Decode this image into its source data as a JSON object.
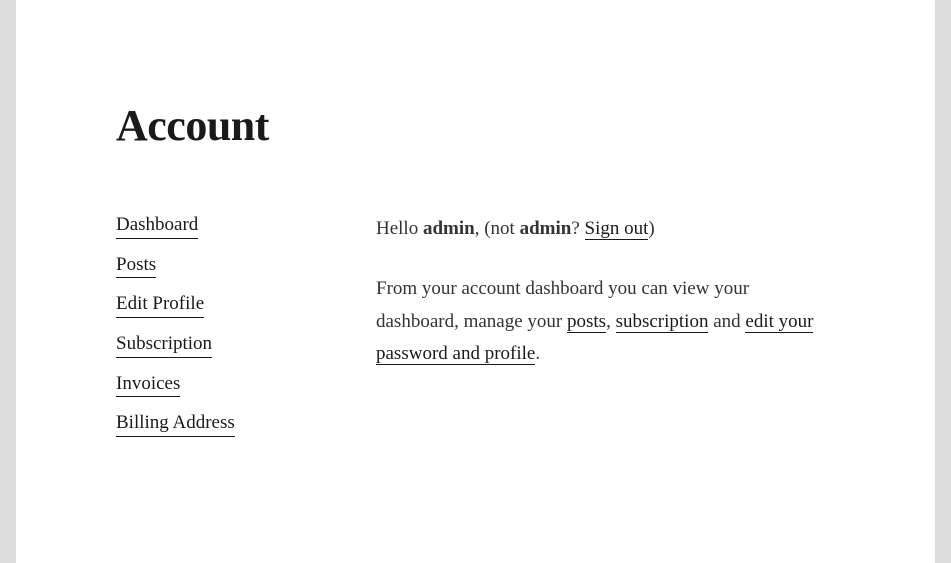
{
  "title": "Account",
  "sidebar": {
    "items": [
      {
        "label": "Dashboard"
      },
      {
        "label": "Posts"
      },
      {
        "label": "Edit Profile"
      },
      {
        "label": "Subscription"
      },
      {
        "label": "Invoices"
      },
      {
        "label": "Billing Address"
      }
    ]
  },
  "main": {
    "greeting_prefix": "Hello ",
    "username": "admin",
    "not_prefix": ", (not ",
    "not_username": "admin",
    "not_qmark": "? ",
    "signout_label": "Sign out",
    "not_suffix": ")",
    "para_prefix": "From your account dashboard you can view your dashboard, manage your ",
    "link_posts": "posts",
    "para_sep1": ", ",
    "link_subscription": "subscription",
    "para_sep2": " and ",
    "link_editprofile": "edit your password and profile",
    "para_suffix": "."
  }
}
